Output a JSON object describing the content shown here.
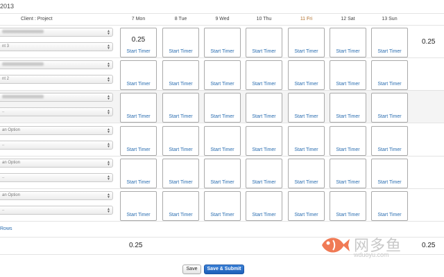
{
  "header": {
    "period_fragment": "2013",
    "client_project_label": "Client : Project",
    "days": [
      "7 Mon",
      "8 Tue",
      "9 Wed",
      "10 Thu",
      "11 Fri",
      "12 Sat",
      "13 Sun"
    ]
  },
  "rows": [
    {
      "project_select": "",
      "task_select": "nt 3",
      "alt": false,
      "hours": "0.25",
      "timer_label": "Start Timer",
      "total": "0.25"
    },
    {
      "project_select": "",
      "task_select": "nt 2",
      "alt": false,
      "hours": "",
      "timer_label": "Start Timer",
      "total": ""
    },
    {
      "project_select": "",
      "task_select": "..",
      "alt": true,
      "hours": "",
      "timer_label": "Start Timer",
      "total": ""
    },
    {
      "project_select": "an Option",
      "task_select": "..",
      "alt": false,
      "hours": "",
      "timer_label": "Start Timer",
      "total": ""
    },
    {
      "project_select": "an Option",
      "task_select": "..",
      "alt": false,
      "hours": "",
      "timer_label": "Start Timer",
      "total": ""
    },
    {
      "project_select": "an Option",
      "task_select": "..",
      "alt": false,
      "hours": "",
      "timer_label": "Start Timer",
      "total": ""
    }
  ],
  "add_rows_label": "Rows",
  "footer": {
    "mon_total": "0.25",
    "grand_total": "0.25"
  },
  "buttons": {
    "save": "Save",
    "submit": "Save & Submit"
  },
  "watermark": {
    "cn": "网多鱼",
    "en": "wduoyu.com"
  },
  "colors": {
    "link": "#2a6db0",
    "primary_button": "#1d5fb8",
    "friday_header": "#b06e2a"
  }
}
